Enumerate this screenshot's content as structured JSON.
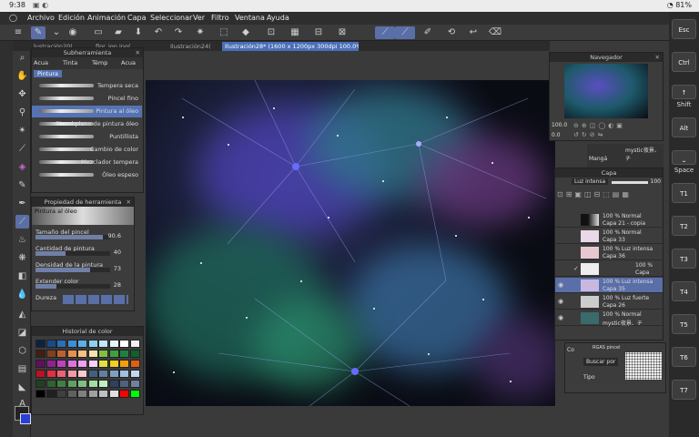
{
  "status": {
    "time": "9:38",
    "battery": "81%"
  },
  "menu": [
    "Archivo",
    "Edición",
    "Animación",
    "Capa",
    "Seleccionar",
    "Ver",
    "Filtro",
    "Ventana",
    "Ayuda"
  ],
  "tabs": [
    {
      "label": "lustración20("
    },
    {
      "label": "flor_ion.jpg("
    },
    {
      "label": "Ilustración24("
    },
    {
      "label": "Ilustración28* (1600 x 1200px 300dpi 100.0%)",
      "active": true
    }
  ],
  "subtool": {
    "title": "Subherramienta",
    "tabs": [
      "Acua",
      "Tinta",
      "Témp",
      "Acua"
    ],
    "active_tab": "Pintura",
    "brushes": [
      "Tempera seca",
      "Pincel fino",
      "Pintura al óleo",
      "Pincel plano de pintura óleo",
      "Puntillista",
      "Cambio de color",
      "Mezclador tempera",
      "Óleo espeso"
    ],
    "selected_index": 2
  },
  "toolprop": {
    "title": "Propiedad de herramienta",
    "preset": "Pintura al óleo",
    "props": [
      {
        "label": "Tamaño del pincel",
        "value": "90.6",
        "fill": 0.9
      },
      {
        "label": "Cantidad de pintura",
        "value": "40",
        "fill": 0.4
      },
      {
        "label": "Densidad de la pintura",
        "value": "73",
        "fill": 0.73
      },
      {
        "label": "Extender color",
        "value": "28",
        "fill": 0.28
      }
    ],
    "hardness_label": "Dureza"
  },
  "colorhistory": {
    "title": "Historial de color",
    "colors": [
      "#102040",
      "#1a4a8a",
      "#2a6fb8",
      "#3a8fd8",
      "#5ab0e8",
      "#8fd0f0",
      "#c0e8f8",
      "#e8f4fa",
      "#ffffff",
      "#f0f0f0",
      "#402010",
      "#804020",
      "#c06030",
      "#e89050",
      "#f8c080",
      "#f8e0b0",
      "#80c040",
      "#40a040",
      "#208040",
      "#106030",
      "#601060",
      "#902090",
      "#c040c0",
      "#e070e0",
      "#f0a0f0",
      "#fad0fa",
      "#e0e040",
      "#f0d020",
      "#f0a010",
      "#e06010",
      "#c01020",
      "#e03040",
      "#f06070",
      "#f898a0",
      "#fac8d0",
      "#406080",
      "#6080a0",
      "#80a0c0",
      "#a0c0e0",
      "#c0d8f0",
      "#204020",
      "#306030",
      "#408040",
      "#60a060",
      "#80c080",
      "#a0e0a0",
      "#c0f0c0",
      "#304060",
      "#506080",
      "#7080a0",
      "#000000",
      "#202020",
      "#404040",
      "#606060",
      "#808080",
      "#a0a0a0",
      "#c0c0c0",
      "#e0e0e0",
      "#ff0000",
      "#00ff00"
    ]
  },
  "navigator": {
    "title": "Navegador",
    "zoom": "100.0",
    "angle": "0.0"
  },
  "layers": {
    "title": "Capa",
    "blend": "Luz intensa",
    "opacity": "100",
    "items": [
      {
        "t1": "100 % Normal",
        "t2": "Capa 21 - copia",
        "visible": false
      },
      {
        "t1": "100 % Normal",
        "t2": "Capa 33",
        "visible": false
      },
      {
        "t1": "100 % Luz intensa",
        "t2": "Capa 36",
        "visible": false
      },
      {
        "t1": "100 %",
        "t2": "Capa",
        "visible": false
      },
      {
        "t1": "100 % Luz intensa",
        "t2": "Capa 35",
        "visible": true,
        "selected": true
      },
      {
        "t1": "100 % Luz fuerte",
        "t2": "Capa 26",
        "visible": true
      },
      {
        "t1": "100 % Normal",
        "t2": "mystic夜景、チ",
        "visible": true
      }
    ],
    "manga": "Mangá",
    "manga_layer": "mystic夜景、チ"
  },
  "brushpanel": {
    "header": "Co",
    "search": "Buscar por",
    "tag": "RGAS pincel",
    "type_label": "Tipo"
  },
  "keys": [
    {
      "label": "Esc"
    },
    {
      "label": "Ctrl"
    },
    {
      "label": "Shift",
      "icon": "↑"
    },
    {
      "label": "Alt"
    },
    {
      "label": "Space",
      "icon": "⎵"
    },
    {
      "label": "T1"
    },
    {
      "label": "T2"
    },
    {
      "label": "T3"
    },
    {
      "label": "T4"
    },
    {
      "label": "T5"
    },
    {
      "label": "T6"
    },
    {
      "label": "T7"
    }
  ]
}
